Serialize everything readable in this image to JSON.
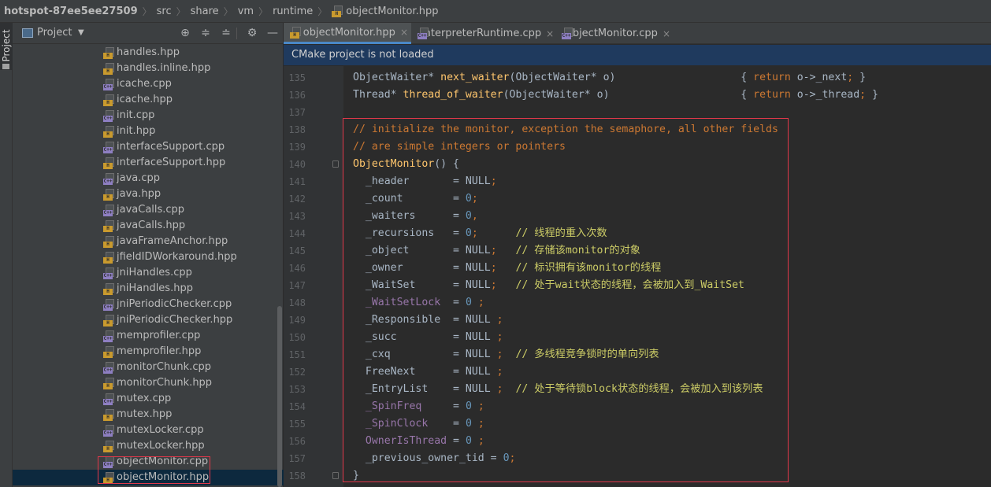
{
  "breadcrumb": {
    "project": "hotspot-87ee5ee27509",
    "parts": [
      "src",
      "share",
      "vm",
      "runtime"
    ],
    "file": "objectMonitor.hpp"
  },
  "tool_stripe": {
    "project_label": "Project"
  },
  "project_panel": {
    "title": "Project",
    "dropdown_icon": "triangle-down",
    "header_icons": [
      "locate-icon",
      "expand-all-icon",
      "collapse-all-icon",
      "gear-icon",
      "minimize-icon"
    ]
  },
  "file_tree": [
    {
      "name": "handles.hpp",
      "type": "hpp"
    },
    {
      "name": "handles.inline.hpp",
      "type": "hpp"
    },
    {
      "name": "icache.cpp",
      "type": "cpp"
    },
    {
      "name": "icache.hpp",
      "type": "hpp"
    },
    {
      "name": "init.cpp",
      "type": "cpp"
    },
    {
      "name": "init.hpp",
      "type": "hpp"
    },
    {
      "name": "interfaceSupport.cpp",
      "type": "cpp"
    },
    {
      "name": "interfaceSupport.hpp",
      "type": "hpp"
    },
    {
      "name": "java.cpp",
      "type": "cpp"
    },
    {
      "name": "java.hpp",
      "type": "hpp"
    },
    {
      "name": "javaCalls.cpp",
      "type": "cpp"
    },
    {
      "name": "javaCalls.hpp",
      "type": "hpp"
    },
    {
      "name": "javaFrameAnchor.hpp",
      "type": "hpp"
    },
    {
      "name": "jfieldIDWorkaround.hpp",
      "type": "hpp"
    },
    {
      "name": "jniHandles.cpp",
      "type": "cpp"
    },
    {
      "name": "jniHandles.hpp",
      "type": "hpp"
    },
    {
      "name": "jniPeriodicChecker.cpp",
      "type": "cpp"
    },
    {
      "name": "jniPeriodicChecker.hpp",
      "type": "hpp"
    },
    {
      "name": "memprofiler.cpp",
      "type": "cpp"
    },
    {
      "name": "memprofiler.hpp",
      "type": "hpp"
    },
    {
      "name": "monitorChunk.cpp",
      "type": "cpp"
    },
    {
      "name": "monitorChunk.hpp",
      "type": "hpp"
    },
    {
      "name": "mutex.cpp",
      "type": "cpp"
    },
    {
      "name": "mutex.hpp",
      "type": "hpp"
    },
    {
      "name": "mutexLocker.cpp",
      "type": "cpp"
    },
    {
      "name": "mutexLocker.hpp",
      "type": "hpp"
    },
    {
      "name": "objectMonitor.cpp",
      "type": "cpp"
    },
    {
      "name": "objectMonitor.hpp",
      "type": "hpp",
      "selected": true
    }
  ],
  "editor_tabs": [
    {
      "label": "objectMonitor.hpp",
      "type": "hpp",
      "active": true,
      "close": "×"
    },
    {
      "label": "interpreterRuntime.cpp",
      "type": "cpp",
      "active": false,
      "close": "×"
    },
    {
      "label": "objectMonitor.cpp",
      "type": "cpp",
      "active": false,
      "close": "×"
    }
  ],
  "banner": {
    "text": "CMake project is not loaded"
  },
  "code": {
    "line_numbers": [
      "135",
      "136",
      "137",
      "138",
      "139",
      "140",
      "141",
      "142",
      "143",
      "144",
      "145",
      "146",
      "147",
      "148",
      "149",
      "150",
      "151",
      "152",
      "153",
      "154",
      "155",
      "156",
      "157",
      "158"
    ],
    "lines": [
      "ObjectWaiter* next_waiter(ObjectWaiter* o)                    { return o->_next; }",
      "Thread* thread_of_waiter(ObjectWaiter* o)                     { return o->_thread; }",
      "",
      "// initialize the monitor, exception the semaphore, all other fields",
      "// are simple integers or pointers",
      "ObjectMonitor() {",
      "  _header       = NULL;",
      "  _count        = 0;",
      "  _waiters      = 0,",
      "  _recursions   = 0;      // 线程的重入次数",
      "  _object       = NULL;   // 存储该monitor的对象",
      "  _owner        = NULL;   // 标识拥有该monitor的线程",
      "  _WaitSet      = NULL;   // 处于wait状态的线程，会被加入到_WaitSet",
      "  _WaitSetLock  = 0 ;",
      "  _Responsible  = NULL ;",
      "  _succ         = NULL ;",
      "  _cxq          = NULL ;  // 多线程竞争锁时的单向列表",
      "  FreeNext      = NULL ;",
      "  _EntryList    = NULL ;  // 处于等待锁block状态的线程，会被加入到该列表",
      "  _SpinFreq     = 0 ;",
      "  _SpinClock    = 0 ;",
      "  OwnerIsThread = 0 ;",
      "  _previous_owner_tid = 0;",
      "}"
    ]
  }
}
